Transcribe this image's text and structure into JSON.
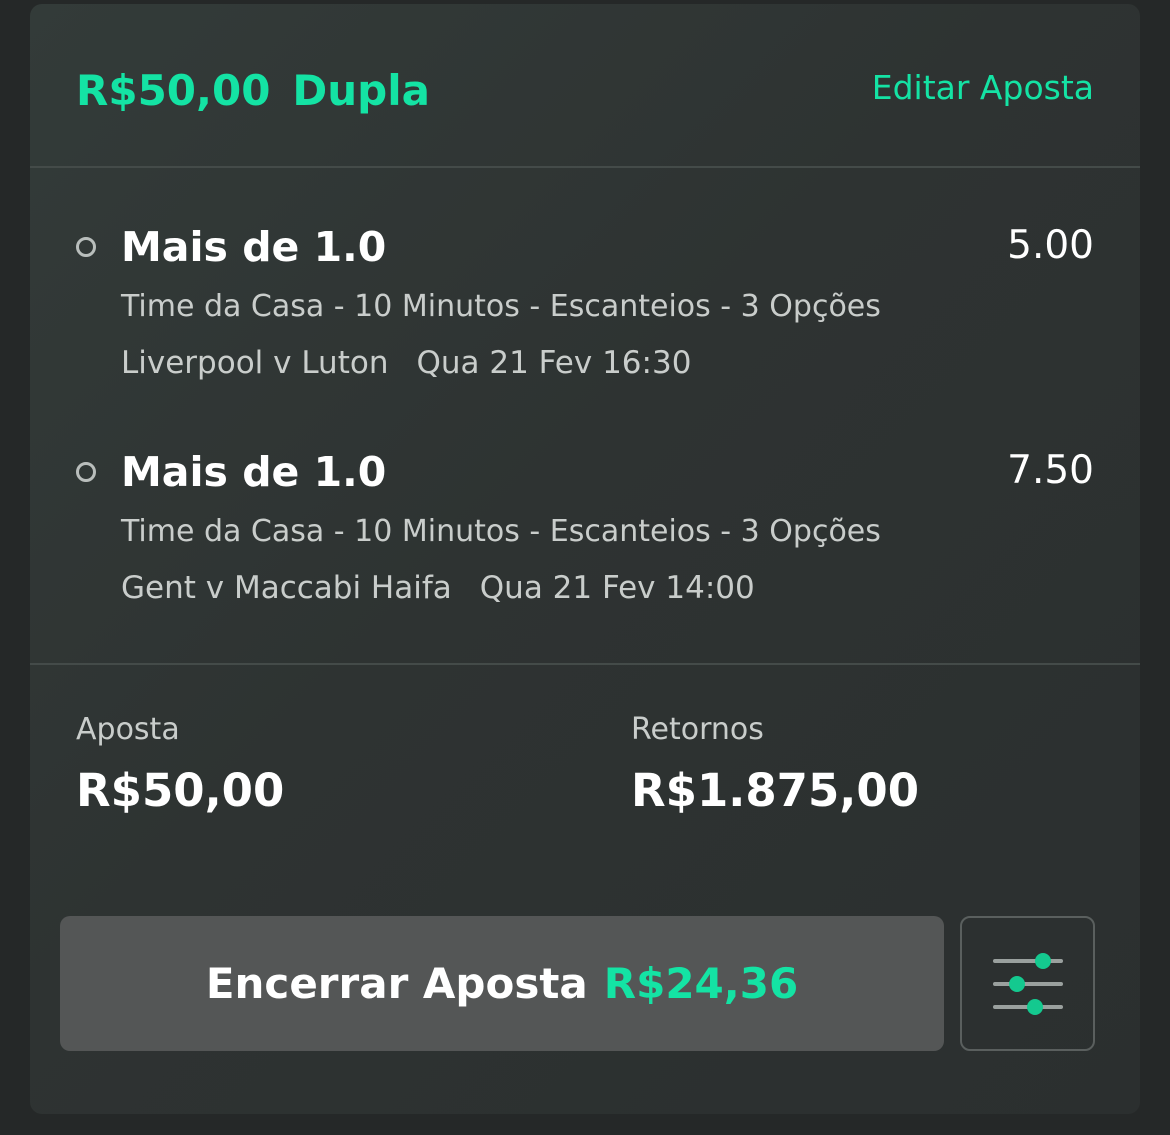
{
  "header": {
    "stake": "R$50,00",
    "bet_type": "Dupla",
    "edit_label": "Editar Aposta"
  },
  "selections": [
    {
      "name": "Mais de 1.0",
      "odds": "5.00",
      "market": "Time da Casa - 10 Minutos - Escanteios - 3 Opções",
      "event": "Liverpool v Luton",
      "datetime": "Qua 21 Fev 16:30"
    },
    {
      "name": "Mais de 1.0",
      "odds": "7.50",
      "market": "Time da Casa - 10 Minutos - Escanteios - 3 Opções",
      "event": "Gent v Maccabi Haifa",
      "datetime": "Qua 21 Fev 14:00"
    }
  ],
  "summary": {
    "stake_label": "Aposta",
    "stake_value": "R$50,00",
    "returns_label": "Retornos",
    "returns_value": "R$1.875,00"
  },
  "cashout": {
    "label": "Encerrar Aposta",
    "value": "R$24,36"
  },
  "icons": {
    "settings": "sliders-icon",
    "selection_marker": "circle-icon"
  },
  "colors": {
    "accent": "#14e3a4",
    "card_bg": "#2e3332",
    "page_bg": "#252828",
    "button_bg": "#545656",
    "text_primary": "#ffffff",
    "text_secondary": "#c9cdcb"
  }
}
